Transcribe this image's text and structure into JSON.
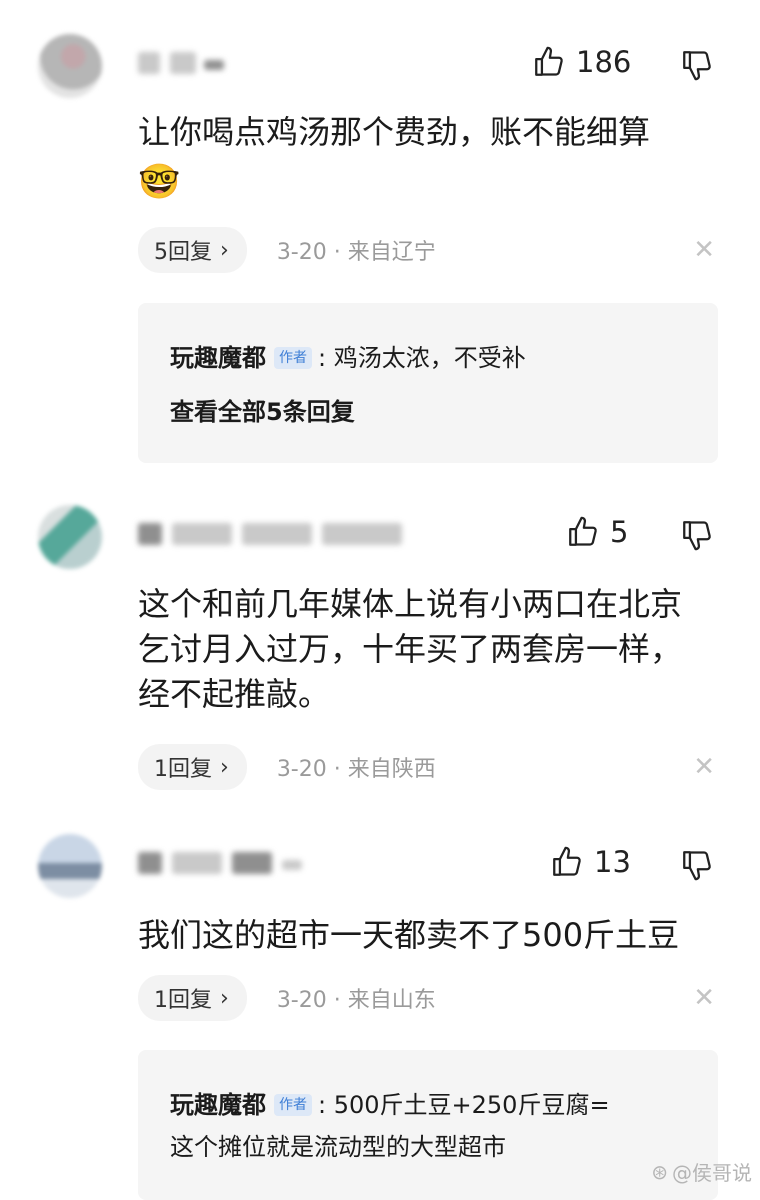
{
  "comments": [
    {
      "likes": "186",
      "text_lines": [
        "让你喝点鸡汤那个费劲，账不能细算"
      ],
      "emoji": "🤓",
      "reply_count": "5回复",
      "date": "3-20",
      "location": "· 来自辽宁",
      "reply": {
        "author": "玩趣魔都",
        "tag": "作者",
        "text": ": 鸡汤太浓，不受补",
        "view_all": "查看全部5条回复"
      }
    },
    {
      "likes": "5",
      "text_lines": [
        "这个和前几年媒体上说有小两口在北京",
        "乞讨月入过万，十年买了两套房一样，",
        "经不起推敲。"
      ],
      "reply_count": "1回复",
      "date": "3-20",
      "location": "· 来自陕西"
    },
    {
      "likes": "13",
      "text_lines": [
        "我们这的超市一天都卖不了500斤土豆"
      ],
      "reply_count": "1回复",
      "date": "3-20",
      "location": "· 来自山东",
      "reply": {
        "author": "玩趣魔都",
        "tag": "作者",
        "text": ": 500斤土豆+250斤豆腐=",
        "text2": "这个摊位就是流动型的大型超市"
      }
    }
  ],
  "icons": {
    "like": "thumbs-up-icon",
    "dislike": "thumbs-down-icon",
    "close": "close-icon",
    "chevron": "chevron-right-icon"
  },
  "ui": {
    "chevron": "›",
    "close": "✕"
  },
  "watermark": {
    "logo": "⊛",
    "text": "@侯哥说"
  },
  "colors": {
    "author_tag": "#3f7fd6",
    "meta": "#9a9a9a",
    "reply_box": "#f5f5f5"
  }
}
